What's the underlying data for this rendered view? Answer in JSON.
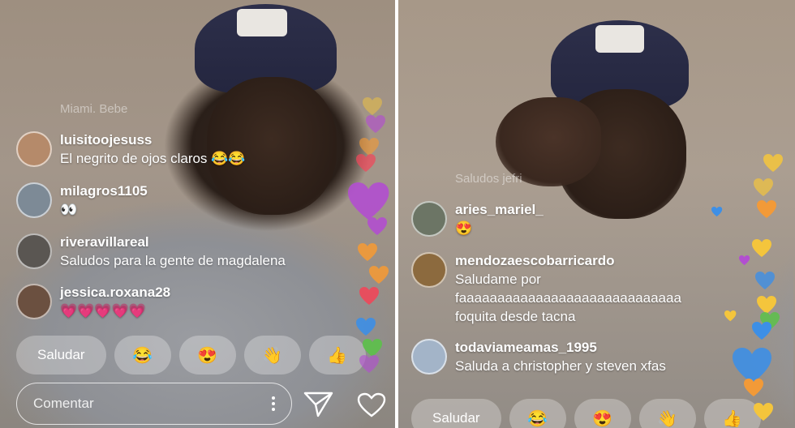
{
  "left": {
    "faded_comment": "Miami. Bebe",
    "comments": [
      {
        "username": "luisitoojesuss",
        "text": "El negrito de ojos claros 😂😂",
        "avatar_color": "#b58a6a"
      },
      {
        "username": "milagros1105",
        "text": "👀",
        "avatar_color": "#7d8a96"
      },
      {
        "username": "riveravillareal",
        "text": "Saludos para la gente de magdalena",
        "avatar_color": "#5a5652"
      },
      {
        "username": "jessica.roxana28",
        "text": "💗💗💗💗💗",
        "avatar_color": "#6b5040"
      }
    ],
    "quick_replies": [
      "Saludar",
      "😂",
      "😍",
      "👋",
      "👍"
    ],
    "comment_placeholder": "Comentar"
  },
  "right": {
    "faded_comment": "Saludos jefri",
    "comments": [
      {
        "username": "aries_mariel_",
        "text": "😍",
        "avatar_color": "#6c7565"
      },
      {
        "username": "mendozaescobarricardo",
        "text": "Saludame por faaaaaaaaaaaaaaaaaaaaaaaaaaaaa foquita desde tacna",
        "text_lines": [
          "Saludame por",
          "faaaaaaaaaaaaaaaaaaaaaaaaaaaaa",
          "foquita desde tacna"
        ],
        "avatar_color": "#8c6a3e"
      },
      {
        "username": "todaviameamas_1995",
        "text": "Saluda a christopher y steven xfas",
        "avatar_color": "#a3b4c8"
      }
    ],
    "quick_replies": [
      "Saludar",
      "😂",
      "😍",
      "👋",
      "👍"
    ]
  },
  "icons": {
    "more": "more-vertical-icon",
    "send": "send-icon",
    "like": "heart-outline-icon"
  },
  "colors": {
    "heart_purple": "#b24fd0",
    "heart_pink": "#ef6fa6",
    "heart_orange": "#f29a38",
    "heart_red": "#f0475a",
    "heart_blue": "#3d8fe6",
    "heart_green": "#5cc24a",
    "heart_yellow": "#f4c53c"
  }
}
